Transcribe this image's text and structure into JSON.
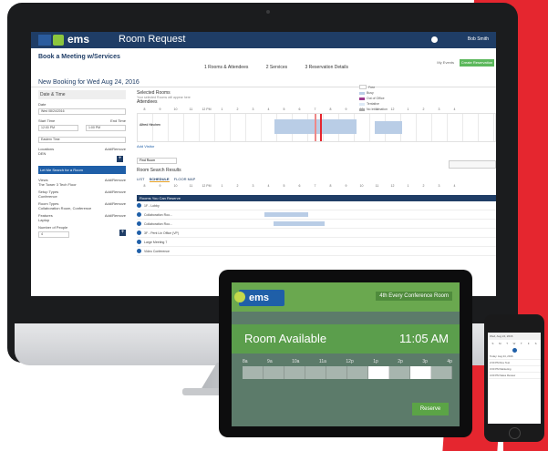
{
  "app": {
    "brand": "ems",
    "title": "Room Request",
    "user": "Bob Smith",
    "breadcrumb": "Book a Meeting w/Services",
    "steps": [
      "1 Rooms & Attendees",
      "2 Services",
      "3 Reservation Details"
    ],
    "my_events": "My Events",
    "create_button": "Create Reservation",
    "new_booking": "New Booking for Wed Aug 24, 2016"
  },
  "left_form": {
    "date_time": "Date & Time",
    "date_label": "Date",
    "date_value": "Wed 08/24/2016",
    "recurrence": "Recurrence",
    "start_label": "Start Time",
    "start_value": "12:00 PM",
    "end_label": "End Time",
    "end_value": "1:00 PM",
    "timezone_label": "Locations",
    "timezone_value": "Eastern Time",
    "locations_label": "Locations",
    "add_remove": "Add/Remove",
    "locations_value": "DEN",
    "search_strip": "Let Me Search for a Room",
    "views_label": "Views",
    "views_value": "The Tower 3 Tech Floor",
    "setup_label": "Setup Types",
    "setup_value": "Conference",
    "room_types_label": "Room Types",
    "room_types_value": "Collaboration Room, Conference",
    "features_label": "Features",
    "features_value": "Laptop",
    "num_people_label": "Number of People",
    "num_people_value": "4"
  },
  "schedule": {
    "selected_rooms": "Selected Rooms",
    "selected_hint": "Your selected Rooms will appear here",
    "attendees": "Attendees",
    "hours": [
      "8",
      "9",
      "10",
      "11",
      "12 PM",
      "1",
      "2",
      "3",
      "4",
      "5",
      "6",
      "7",
      "8",
      "9",
      "10",
      "11",
      "12",
      "1",
      "2",
      "3",
      "4"
    ],
    "attendee_name": "Alfred Hinchen",
    "add_row": "Add Visitor",
    "room_search": "Room Search Results",
    "tabs": [
      "LIST",
      "SCHEDULE",
      "FLOOR MAP"
    ],
    "rooms_can_reserve": "Rooms You Can Reserve",
    "rooms": [
      "1F - Lobby",
      "Collaboration Roo...",
      "Collaboration Roo...",
      "3F - Pent Lin Office (VP)",
      "Large Meeting 7",
      "Video Conference"
    ],
    "find_room": "Find Room",
    "legend": [
      "Free",
      "Busy",
      "Out of Office",
      "Tentative",
      "No Information"
    ]
  },
  "tablet": {
    "brand": "ems",
    "room_name": "4th Every Conference Room",
    "status": "Room Available",
    "time": "11:05 AM",
    "hours": [
      "8a",
      "9a",
      "10a",
      "11a",
      "12p",
      "1p",
      "2p",
      "3p",
      "4p"
    ],
    "reserve": "Reserve"
  },
  "phone": {
    "header": "Wed, Aug 24, 2016",
    "days": [
      "S",
      "M",
      "T",
      "W",
      "T",
      "F",
      "S"
    ],
    "lines": [
      "Today: Aug 24, 2016",
      "2:00 PM Dev Test",
      "3:00 PM Marketing",
      "4:00 PM Sales Review"
    ]
  },
  "colors": {
    "brand_navy": "#1f3d66",
    "accent_green": "#6aa84f",
    "accent_red": "#e5262f"
  }
}
